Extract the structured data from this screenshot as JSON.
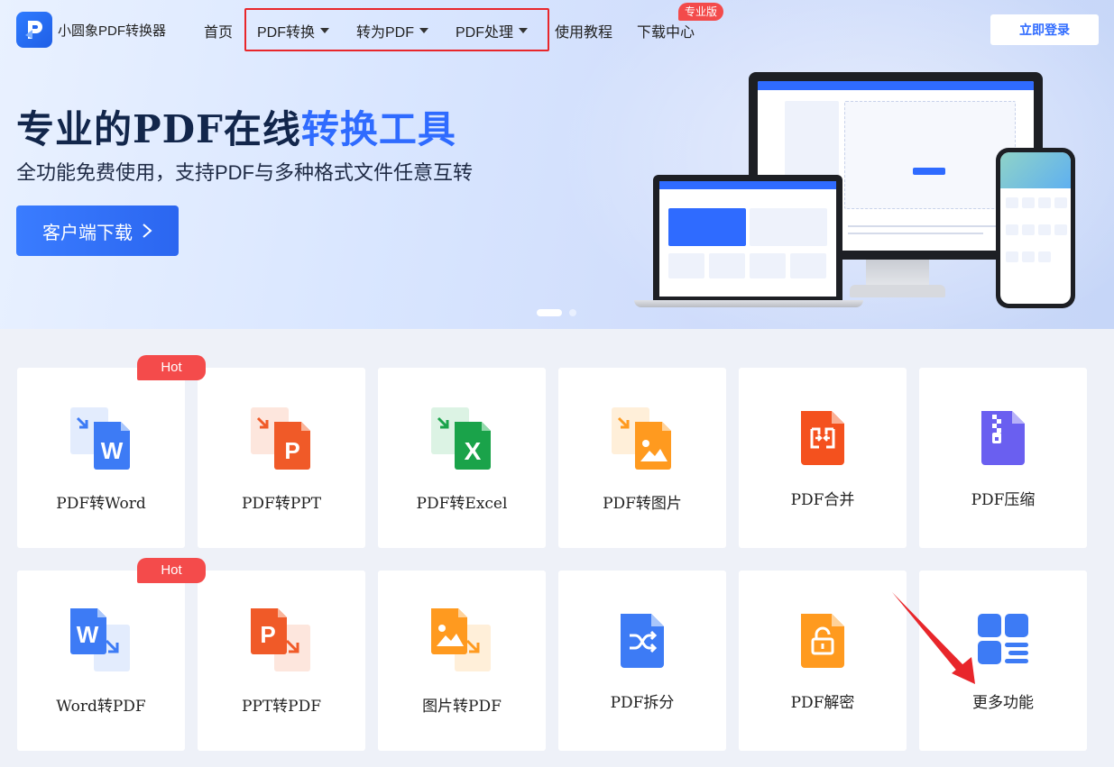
{
  "header": {
    "logo_text": "小圆象PDF转换器",
    "nav": [
      {
        "label": "首页",
        "has_dropdown": false
      },
      {
        "label": "PDF转换",
        "has_dropdown": true
      },
      {
        "label": "转为PDF",
        "has_dropdown": true
      },
      {
        "label": "PDF处理",
        "has_dropdown": true
      },
      {
        "label": "使用教程",
        "has_dropdown": false
      },
      {
        "label": "下载中心",
        "has_dropdown": false
      }
    ],
    "pro_badge": "专业版",
    "login_label": "立即登录"
  },
  "hero": {
    "title_part1": "专业的PDF在线",
    "title_part2": "转换工具",
    "subtitle": "全功能免费使用，支持PDF与多种格式文件任意互转",
    "download_label": "客户端下载",
    "carousel": {
      "count": 2,
      "active": 0
    }
  },
  "cards": [
    {
      "label": "PDF转Word",
      "hot": true,
      "icon": "pdf-to-word-icon"
    },
    {
      "label": "PDF转PPT",
      "hot": false,
      "icon": "pdf-to-ppt-icon"
    },
    {
      "label": "PDF转Excel",
      "hot": false,
      "icon": "pdf-to-excel-icon"
    },
    {
      "label": "PDF转图片",
      "hot": false,
      "icon": "pdf-to-image-icon"
    },
    {
      "label": "PDF合并",
      "hot": false,
      "icon": "pdf-merge-icon"
    },
    {
      "label": "PDF压缩",
      "hot": false,
      "icon": "pdf-compress-icon"
    },
    {
      "label": "Word转PDF",
      "hot": true,
      "icon": "word-to-pdf-icon"
    },
    {
      "label": "PPT转PDF",
      "hot": false,
      "icon": "ppt-to-pdf-icon"
    },
    {
      "label": "图片转PDF",
      "hot": false,
      "icon": "image-to-pdf-icon"
    },
    {
      "label": "PDF拆分",
      "hot": false,
      "icon": "pdf-split-icon"
    },
    {
      "label": "PDF解密",
      "hot": false,
      "icon": "pdf-decrypt-icon"
    },
    {
      "label": "更多功能",
      "hot": false,
      "icon": "more-features-icon"
    }
  ],
  "hot_label": "Hot",
  "colors": {
    "brand_blue": "#2f6bff",
    "word_blue": "#3d7bf5",
    "ppt_orange": "#f05a28",
    "excel_green": "#1aa34a",
    "image_orange": "#ff9a1f",
    "merge_red": "#f4511e",
    "compress_purple": "#6a5ff0",
    "hot_red": "#f44b4b",
    "annotation_red": "#e8262b"
  }
}
